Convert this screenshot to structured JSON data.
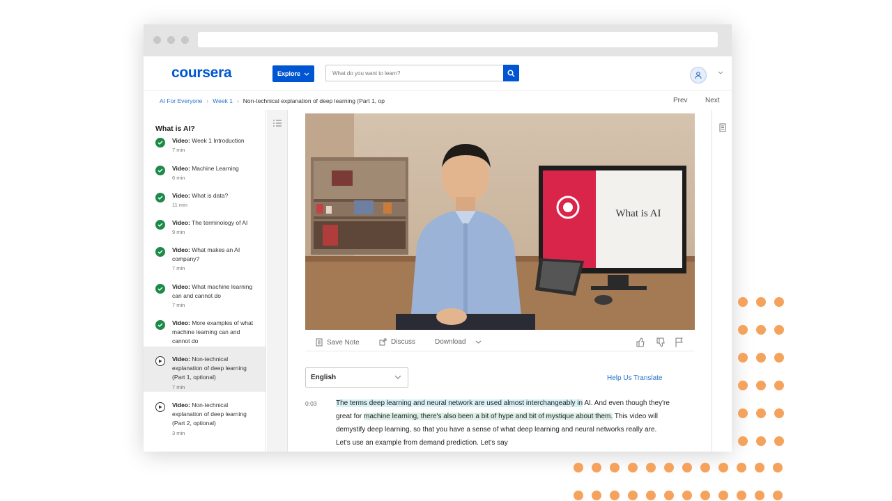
{
  "header": {
    "logo": "coursera",
    "explore_label": "Explore",
    "search_placeholder": "What do you want to learn?"
  },
  "breadcrumb": {
    "items": [
      "AI For Everyone",
      "Week 1",
      "Non-technical explanation of deep learning (Part 1, op"
    ],
    "prev": "Prev",
    "next": "Next"
  },
  "sidebar": {
    "title": "What is AI?",
    "items": [
      {
        "kind": "Video:",
        "title": "Week 1 Introduction",
        "duration": "7 min",
        "status": "complete"
      },
      {
        "kind": "Video:",
        "title": "Machine Learning",
        "duration": "6 min",
        "status": "complete"
      },
      {
        "kind": "Video:",
        "title": "What is data?",
        "duration": "11 min",
        "status": "complete"
      },
      {
        "kind": "Video:",
        "title": "The terminology of AI",
        "duration": "9 min",
        "status": "complete"
      },
      {
        "kind": "Video:",
        "title": "What makes an AI company?",
        "duration": "7 min",
        "status": "complete"
      },
      {
        "kind": "Video:",
        "title": "What machine learning can and cannot do",
        "duration": "7 min",
        "status": "complete"
      },
      {
        "kind": "Video:",
        "title": "More examples of what machine learning can and cannot do",
        "duration": "8 min",
        "status": "complete"
      },
      {
        "kind": "Video:",
        "title": "Non-technical explanation of deep learning (Part 1, optional)",
        "duration": "7 min",
        "status": "current"
      },
      {
        "kind": "Video:",
        "title": "Non-technical explanation of deep learning (Part 2, optional)",
        "duration": "3 min",
        "status": "pending"
      }
    ]
  },
  "video": {
    "slide_title": "What is AI",
    "slide_subtitle": "Non-technical explanation of deep learning (Part 1, optional)"
  },
  "toolbar": {
    "save_note": "Save Note",
    "discuss": "Discuss",
    "download": "Download"
  },
  "language": {
    "selected": "English",
    "help_translate": "Help Us Translate"
  },
  "transcript": {
    "timestamp": "0:03",
    "seg1": "The terms deep learning and neural network are used almost interchangeably in",
    "seg2": " AI. And even though they're great for ",
    "seg3": "machine learning, there's also been a bit of hype and bit of mystique about them.",
    "seg4": " This video will demystify deep learning, so that you have a sense of what deep learning and neural networks really are. Let's use an example from demand prediction. Let's say"
  },
  "colors": {
    "brand": "#0056d2",
    "complete": "#1d8a4a",
    "accent_dots": "#f5a35c",
    "highlight": "#dcefe6"
  }
}
